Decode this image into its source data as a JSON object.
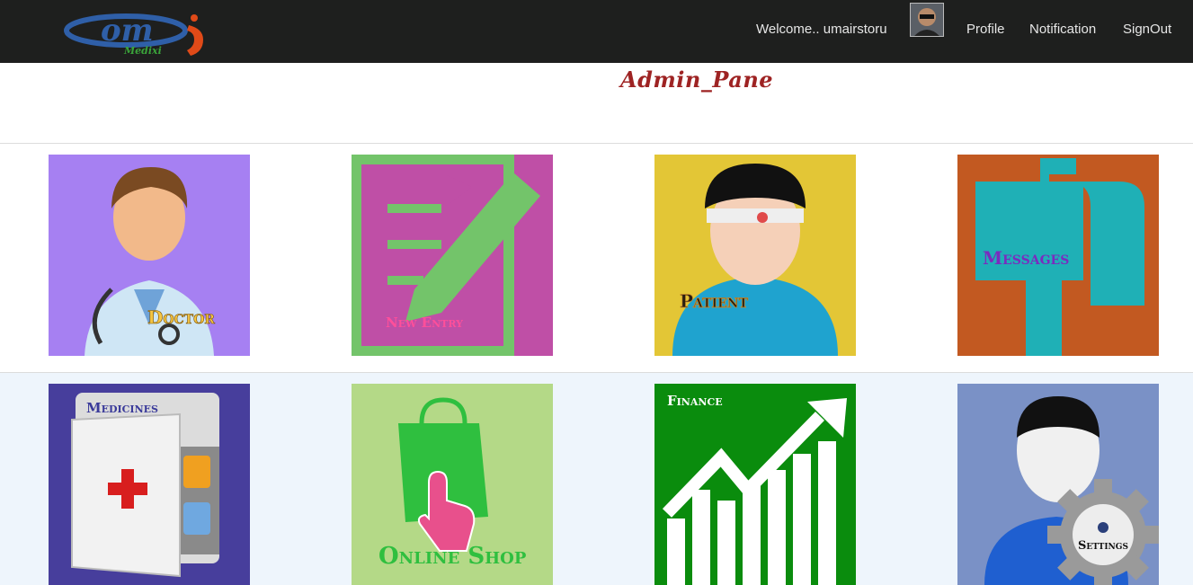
{
  "brand": {
    "logo_text": "om",
    "logo_sub": "Medixi"
  },
  "header": {
    "welcome": "Welcome.. umairstoru",
    "nav": [
      "Profile",
      "Notification",
      "SignOut"
    ]
  },
  "page": {
    "title": "Admin_Pane"
  },
  "tiles": [
    {
      "label": "Doctor",
      "bg": "#a680f2"
    },
    {
      "label": "New Entry",
      "bg": "#bf4fa6"
    },
    {
      "label": "Patient",
      "bg": "#e3c636"
    },
    {
      "label": "Messages",
      "bg": "#c25921"
    },
    {
      "label": "Medicines",
      "bg": "#473e9c"
    },
    {
      "label": "Online Shop",
      "bg": "#b4d987"
    },
    {
      "label": "Finance",
      "bg": "#0a8c0d"
    },
    {
      "label": "Settings",
      "bg": "#7a91c6"
    }
  ]
}
